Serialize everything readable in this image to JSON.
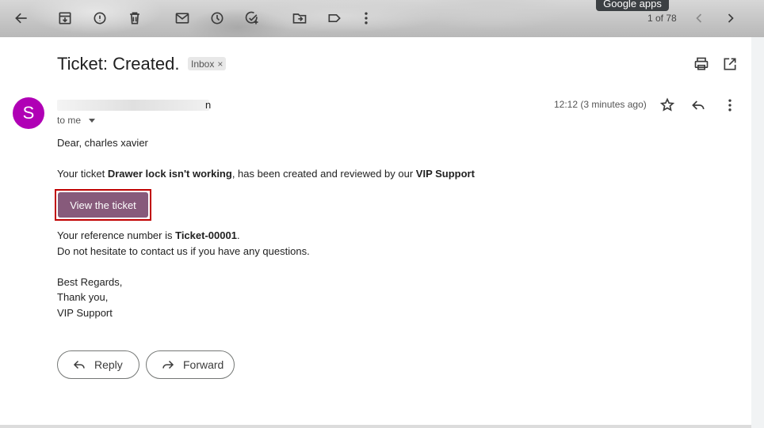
{
  "toolbar": {
    "back": "arrow-back-icon",
    "archive": "archive-icon",
    "spam": "report-spam-icon",
    "delete": "delete-icon",
    "mark_unread": "mail-icon",
    "snooze": "clock-icon",
    "add_task": "add-task-icon",
    "move": "move-to-icon",
    "labels": "label-icon",
    "more": "more-vert-icon",
    "pager_text": "1 of 78",
    "tooltip": "Google apps"
  },
  "email": {
    "subject": "Ticket: Created.",
    "label": "Inbox",
    "label_remove": "×",
    "avatar_letter": "S",
    "sender_tail": "n",
    "to": "to me",
    "timestamp": "12:12 (3 minutes ago)",
    "body": {
      "greeting": "Dear, charles xavier",
      "line1_pre": "Your ticket ",
      "ticket_name": "Drawer lock isn't working",
      "line1_mid": ", has been created and reviewed by our ",
      "team": "VIP Support",
      "button": "View the ticket",
      "ref_pre": "Your reference number is ",
      "ref_number": "Ticket-00001",
      "ref_post": ".",
      "contact": "Do not hesitate to contact us if you have any questions.",
      "closing1": "Best Regards,",
      "closing2": "Thank you,",
      "signature": "VIP Support"
    }
  },
  "actions": {
    "reply": "Reply",
    "forward": "Forward"
  },
  "colors": {
    "avatar": "#b000b5",
    "button": "#875a7b",
    "highlight": "#c00000"
  }
}
